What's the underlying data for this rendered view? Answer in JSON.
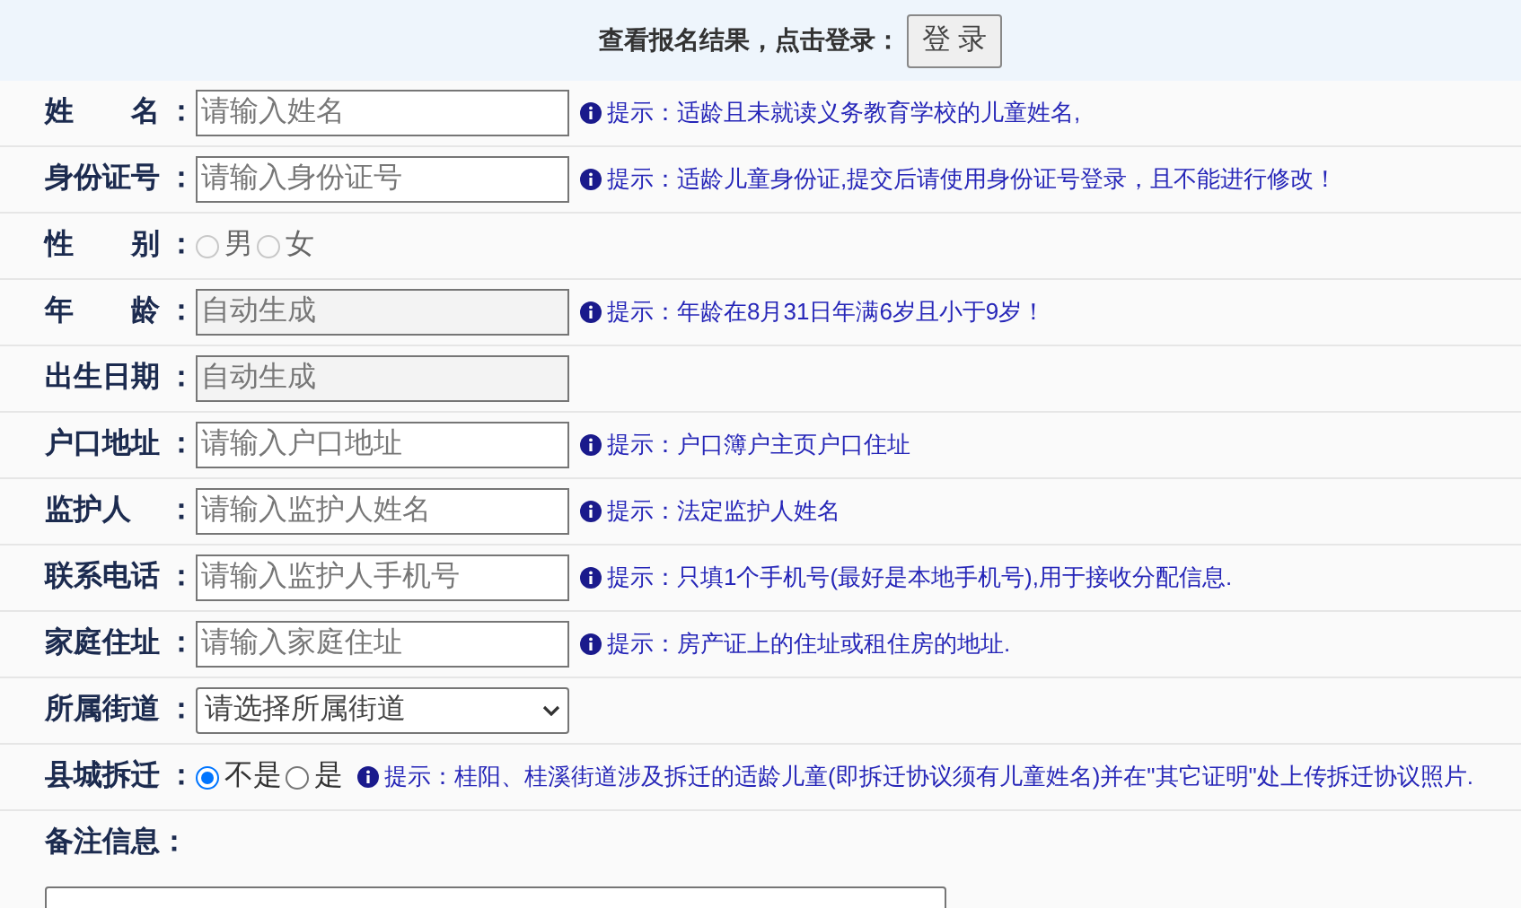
{
  "header": {
    "text": "查看报名结果，点击登录：",
    "button": "登 录"
  },
  "rows": [
    {
      "kind": "text",
      "label": "姓　　名",
      "colon": "：",
      "placeholder": "请输入姓名",
      "disabled": false,
      "hint": "提示：适龄且未就读义务教育学校的儿童姓名,"
    },
    {
      "kind": "text",
      "label": "身份证号",
      "colon": "：",
      "placeholder": "请输入身份证号",
      "disabled": false,
      "hint": "提示：适龄儿童身份证,提交后请使用身份证号登录，且不能进行修改！"
    },
    {
      "kind": "radio",
      "label": "性　　别",
      "colon": "：",
      "options": [
        {
          "label": "男",
          "selected": false,
          "disabled": true
        },
        {
          "label": "女",
          "selected": false,
          "disabled": true
        }
      ]
    },
    {
      "kind": "text",
      "label": "年　　龄",
      "colon": "：",
      "placeholder": "自动生成",
      "disabled": true,
      "hint": "提示：年龄在8月31日年满6岁且小于9岁！"
    },
    {
      "kind": "text",
      "label": "出生日期",
      "colon": "：",
      "placeholder": "自动生成",
      "disabled": true
    },
    {
      "kind": "text",
      "label": "户口地址",
      "colon": "：",
      "placeholder": "请输入户口地址",
      "disabled": false,
      "hint": "提示：户口簿户主页户口住址"
    },
    {
      "kind": "text",
      "label": "监护人",
      "colon": "：",
      "placeholder": "请输入监护人姓名",
      "disabled": false,
      "hint": "提示：法定监护人姓名"
    },
    {
      "kind": "text",
      "label": "联系电话",
      "colon": "：",
      "placeholder": "请输入监护人手机号",
      "disabled": false,
      "hint": "提示：只填1个手机号(最好是本地手机号),用于接收分配信息."
    },
    {
      "kind": "text",
      "label": "家庭住址",
      "colon": "：",
      "placeholder": "请输入家庭住址",
      "disabled": false,
      "hint": "提示：房产证上的住址或租住房的地址."
    },
    {
      "kind": "select",
      "label": "所属街道",
      "colon": "：",
      "value": "请选择所属街道"
    },
    {
      "kind": "radio",
      "label": "县城拆迁",
      "colon": "：",
      "options": [
        {
          "label": "不是",
          "selected": true,
          "disabled": false
        },
        {
          "label": "是",
          "selected": false,
          "disabled": false
        }
      ],
      "hint": "提示：桂阳、桂溪街道涉及拆迁的适龄儿童(即拆迁协议须有儿童姓名)并在\"其它证明\"处上传拆迁协议照片."
    },
    {
      "kind": "textarea",
      "label": "备注信息",
      "colon": "："
    }
  ]
}
